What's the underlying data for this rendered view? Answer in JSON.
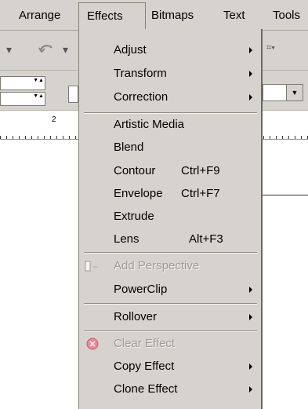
{
  "menubar": {
    "arrange": "Arrange",
    "effects": "Effects",
    "bitmaps": "Bitmaps",
    "text": "Text",
    "tools": "Tools"
  },
  "ruler": {
    "tick_label": "2"
  },
  "menu": {
    "adjust": "Adjust",
    "transform": "Transform",
    "correction": "Correction",
    "artistic_media": "Artistic Media",
    "blend": "Blend",
    "contour": "Contour",
    "contour_shortcut": "Ctrl+F9",
    "envelope": "Envelope",
    "envelope_shortcut": "Ctrl+F7",
    "extrude": "Extrude",
    "lens": "Lens",
    "lens_shortcut": "Alt+F3",
    "add_perspective": "Add Perspective",
    "powerclip": "PowerClip",
    "rollover": "Rollover",
    "clear_effect": "Clear Effect",
    "copy_effect": "Copy Effect",
    "clone_effect": "Clone Effect"
  },
  "colors": {
    "chrome": "#d6d3ce",
    "disabled_text": "#9e9b94"
  }
}
